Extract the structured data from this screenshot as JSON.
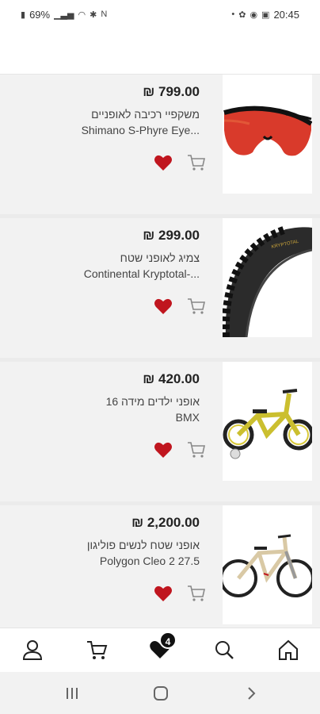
{
  "status": {
    "battery": "69%",
    "time": "20:45"
  },
  "products": [
    {
      "price": "₪ 799.00",
      "title_line1": "משקפיי רכיבה לאופניים",
      "title_line2": "Shimano S-Phyre Eye...",
      "image_icon": "sunglasses",
      "favorited": true
    },
    {
      "price": "₪ 299.00",
      "title_line1": "צמיג לאופני שטח",
      "title_line2": "Continental Kryptotal-...",
      "image_icon": "tire",
      "favorited": true
    },
    {
      "price": "₪ 420.00",
      "title_line1": "אופני ילדים מידה 16",
      "title_line2": "BMX",
      "image_icon": "kids-bike",
      "favorited": true
    },
    {
      "price": "₪ 2,200.00",
      "title_line1": "אופני שטח לנשים פוליגון",
      "title_line2": "Polygon Cleo 2 27.5",
      "image_icon": "mountain-bike",
      "favorited": true
    }
  ],
  "bottom_nav": {
    "items": [
      "profile",
      "cart",
      "favorites",
      "search",
      "home"
    ],
    "favorites_badge": "4"
  },
  "colors": {
    "heart": "#c0161f",
    "list_bg": "#f2f2f2"
  }
}
